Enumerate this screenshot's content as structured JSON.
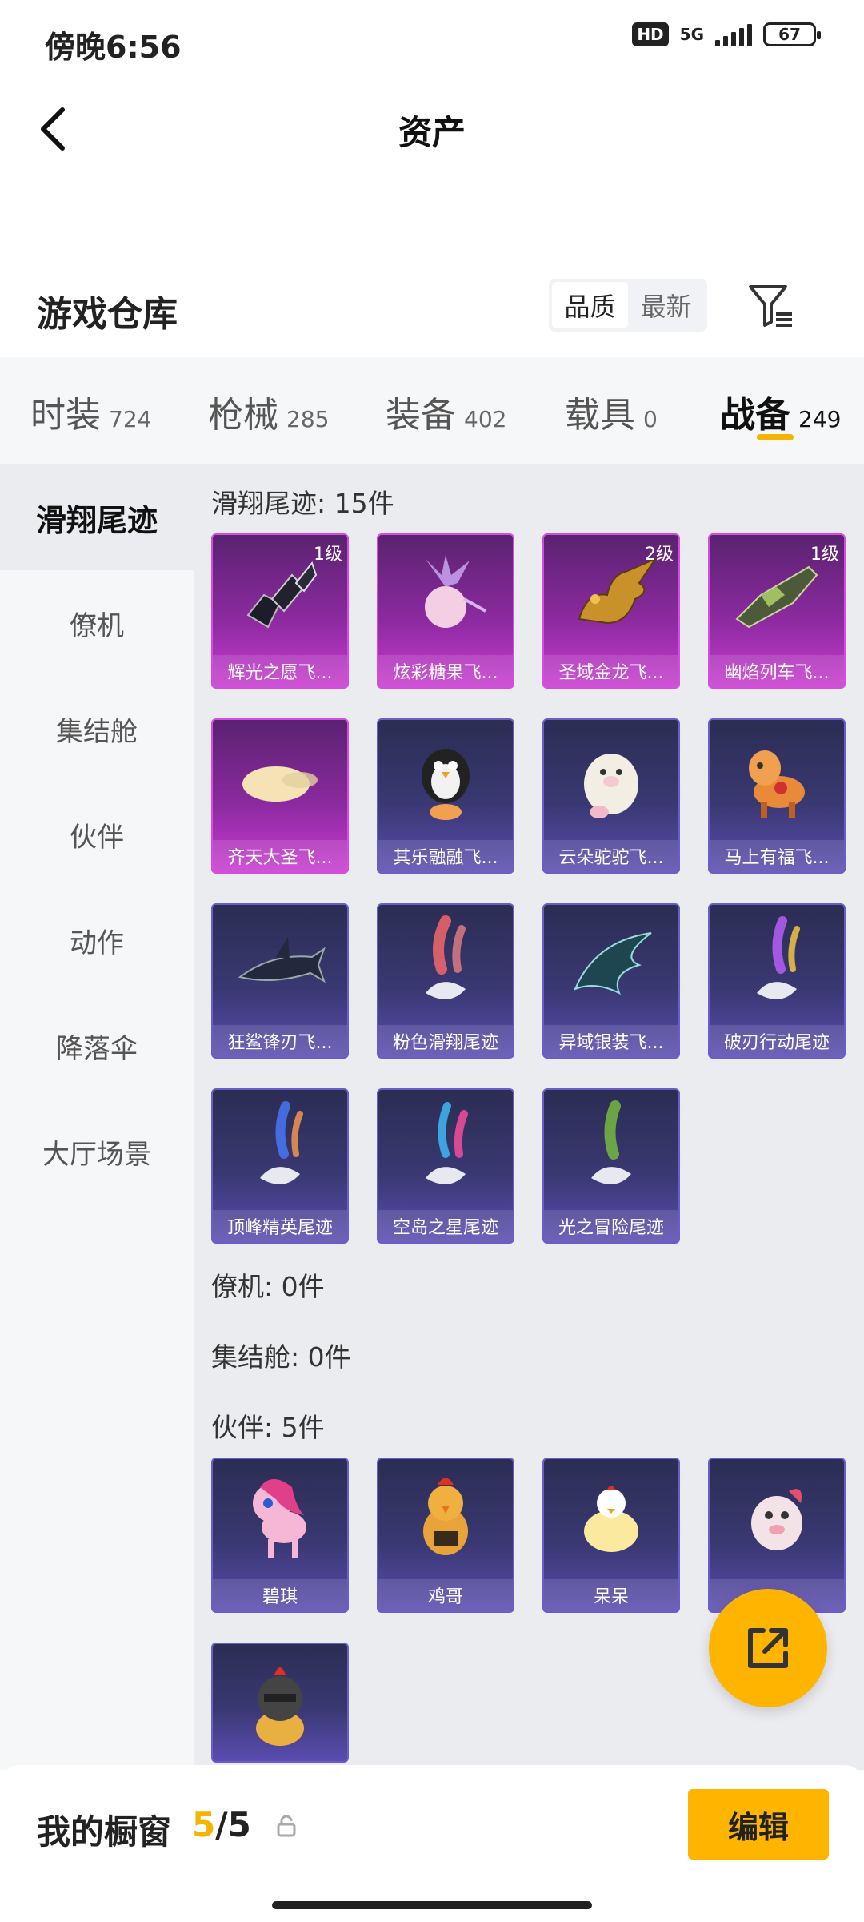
{
  "status": {
    "time": "傍晚6:56",
    "hd": "HD",
    "network": "5G",
    "battery": "67"
  },
  "header": {
    "title": "资产"
  },
  "warehouse": {
    "title": "游戏仓库",
    "sort_options": [
      "品质",
      "最新"
    ],
    "sort_selected": "品质"
  },
  "categories": [
    {
      "label": "时装",
      "count": "724"
    },
    {
      "label": "枪械",
      "count": "285"
    },
    {
      "label": "装备",
      "count": "402"
    },
    {
      "label": "载具",
      "count": "0"
    },
    {
      "label": "战备",
      "count": "249"
    }
  ],
  "category_selected": "战备",
  "sidebar": {
    "items": [
      {
        "label": "滑翔尾迹"
      },
      {
        "label": "僚机"
      },
      {
        "label": "集结舱"
      },
      {
        "label": "伙伴"
      },
      {
        "label": "动作"
      },
      {
        "label": "降落伞"
      },
      {
        "label": "大厅场景"
      }
    ],
    "selected": "滑翔尾迹"
  },
  "sections": [
    {
      "title": "滑翔尾迹: 15件",
      "items": [
        {
          "name": "辉光之愿飞...",
          "badge": "1级",
          "rarity": "purple",
          "icon": "gem-crystals-icon"
        },
        {
          "name": "炫彩糖果飞...",
          "badge": "",
          "rarity": "purple",
          "icon": "candy-icon"
        },
        {
          "name": "圣域金龙飞...",
          "badge": "2级",
          "rarity": "purple",
          "icon": "dragon-icon"
        },
        {
          "name": "幽焰列车飞...",
          "badge": "1级",
          "rarity": "purple",
          "icon": "train-icon"
        },
        {
          "name": "齐天大圣飞...",
          "badge": "",
          "rarity": "purple",
          "icon": "cloud-icon"
        },
        {
          "name": "其乐融融飞...",
          "badge": "",
          "rarity": "blue",
          "icon": "penguin-icon"
        },
        {
          "name": "云朵驼驼飞...",
          "badge": "",
          "rarity": "blue",
          "icon": "alpaca-icon"
        },
        {
          "name": "马上有福飞...",
          "badge": "",
          "rarity": "blue",
          "icon": "horse-icon"
        },
        {
          "name": "狂鲨锋刃飞...",
          "badge": "",
          "rarity": "blue",
          "icon": "shark-icon"
        },
        {
          "name": "粉色滑翔尾迹",
          "badge": "",
          "rarity": "blue",
          "icon": "pink-smoke-icon"
        },
        {
          "name": "异域银装飞...",
          "badge": "",
          "rarity": "blue",
          "icon": "wing-icon"
        },
        {
          "name": "破刃行动尾迹",
          "badge": "",
          "rarity": "blue",
          "icon": "rainbow-smoke-icon"
        },
        {
          "name": "顶峰精英尾迹",
          "badge": "",
          "rarity": "blue",
          "icon": "blue-smoke-icon"
        },
        {
          "name": "空岛之星尾迹",
          "badge": "",
          "rarity": "blue",
          "icon": "star-smoke-icon"
        },
        {
          "name": "光之冒险尾迹",
          "badge": "",
          "rarity": "blue",
          "icon": "green-smoke-icon"
        }
      ]
    },
    {
      "title": "僚机: 0件",
      "items": []
    },
    {
      "title": "集结舱: 0件",
      "items": []
    },
    {
      "title": "伙伴: 5件",
      "items": [
        {
          "name": "碧琪",
          "badge": "",
          "rarity": "blue",
          "icon": "pony-icon"
        },
        {
          "name": "鸡哥",
          "badge": "",
          "rarity": "blue",
          "icon": "chicken-icon"
        },
        {
          "name": "呆呆",
          "badge": "",
          "rarity": "blue",
          "icon": "chick-icon"
        },
        {
          "name": "",
          "badge": "",
          "rarity": "blue",
          "icon": "bird-icon"
        },
        {
          "name": "",
          "badge": "",
          "rarity": "blue",
          "icon": "helmet-chick-icon"
        }
      ]
    }
  ],
  "showcase": {
    "label": "我的橱窗",
    "current": "5",
    "total": "5",
    "edit_label": "编辑"
  },
  "colors": {
    "accent": "#ffb400",
    "purple_card": "#a032b8",
    "blue_card": "#3a3872"
  }
}
